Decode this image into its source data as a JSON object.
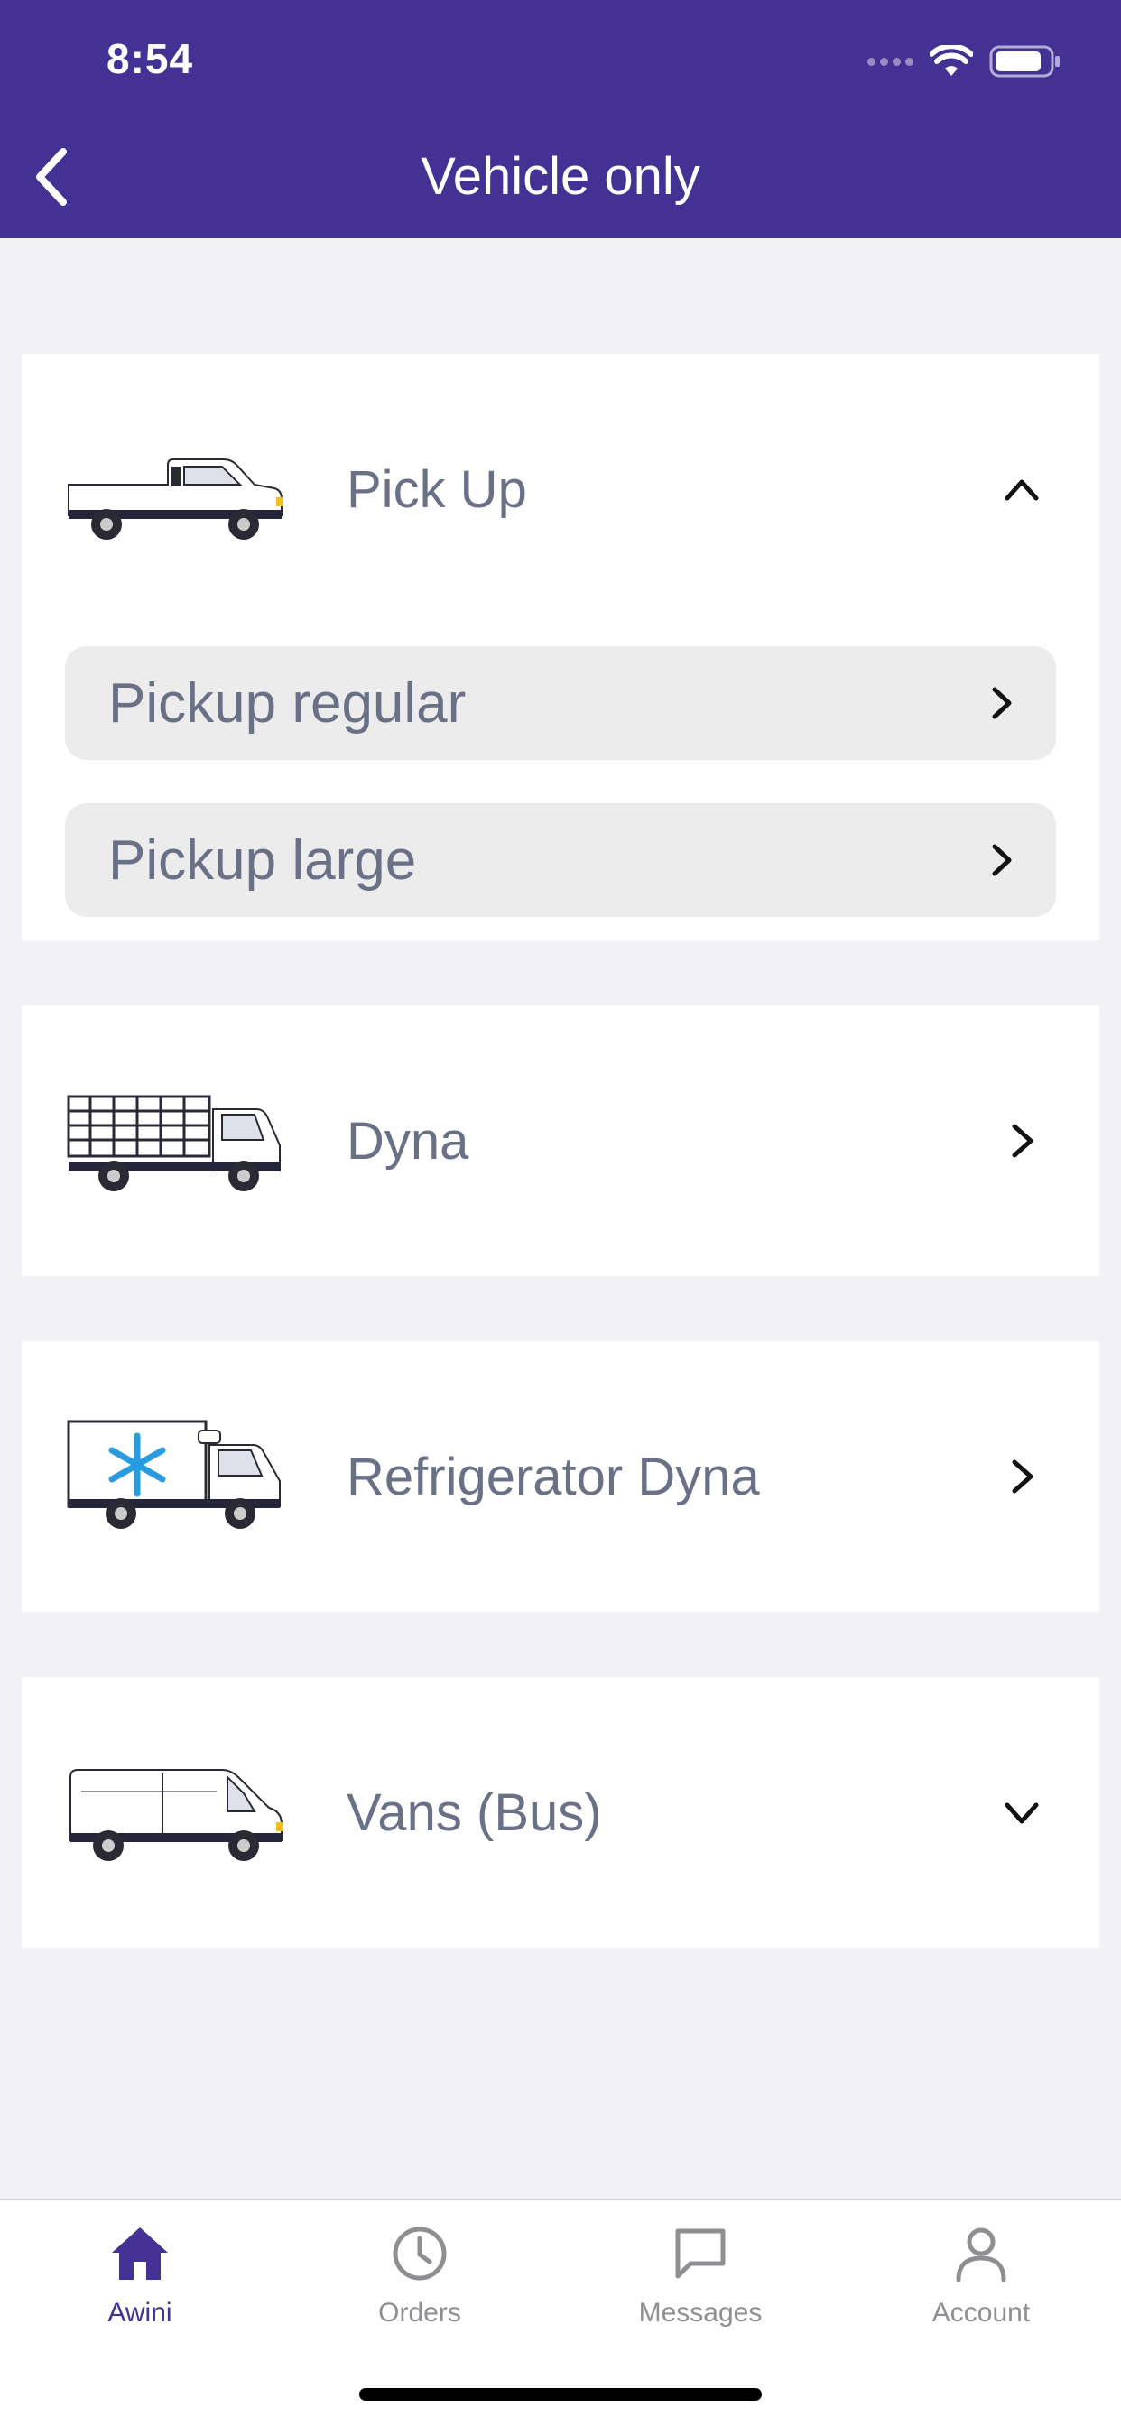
{
  "status_bar": {
    "time": "8:54"
  },
  "header": {
    "title": "Vehicle only",
    "bg_color": "#433193"
  },
  "vehicles": [
    {
      "label": "Pick Up",
      "icon": "pickup-truck-image",
      "expanded": true,
      "chevron": "chevron-up-icon",
      "sub_items": [
        {
          "label": "Pickup regular"
        },
        {
          "label": "Pickup large"
        }
      ]
    },
    {
      "label": "Dyna",
      "icon": "dyna-truck-image",
      "chevron": "chevron-right-icon"
    },
    {
      "label": "Refrigerator Dyna",
      "icon": "refrigerator-truck-image",
      "chevron": "chevron-right-icon"
    },
    {
      "label": "Vans (Bus)",
      "icon": "van-image",
      "expanded": false,
      "chevron": "chevron-down-icon"
    }
  ],
  "tabbar": {
    "tabs": [
      {
        "label": "Awini",
        "icon": "home-icon",
        "active": true
      },
      {
        "label": "Orders",
        "icon": "clock-icon",
        "active": false
      },
      {
        "label": "Messages",
        "icon": "message-icon",
        "active": false
      },
      {
        "label": "Account",
        "icon": "person-icon",
        "active": false
      }
    ],
    "active_color": "#433193",
    "inactive_color": "#8e8e93"
  }
}
